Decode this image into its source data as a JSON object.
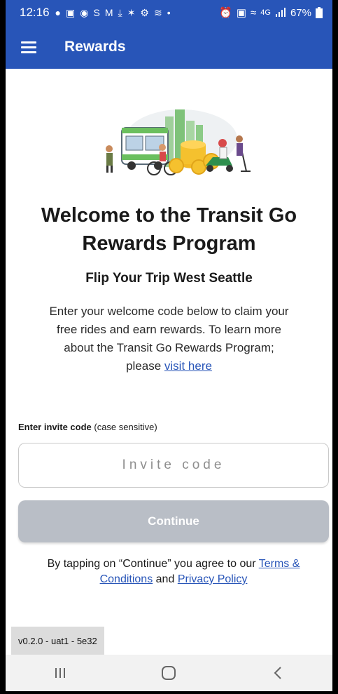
{
  "status_bar": {
    "time": "12:16",
    "left_icons": [
      "●",
      "▣",
      "◉",
      "S",
      "M",
      "⤓",
      "✶",
      "⚙",
      "≋",
      "•"
    ],
    "right_icons": [
      "⏰",
      "▣",
      "≈"
    ],
    "network": "4G",
    "battery": "67%"
  },
  "app_bar": {
    "title": "Rewards"
  },
  "content": {
    "headline": "Welcome to the Transit Go Rewards Program",
    "subheadline": "Flip Your Trip West Seattle",
    "description_text": "Enter your welcome code below to claim your free rides and earn rewards. To learn more about the Transit Go Rewards Program; please",
    "description_link": "visit here"
  },
  "form": {
    "label": "Enter invite code",
    "label_note": "(case sensitive)",
    "input_placeholder": "Invite code",
    "input_value": "",
    "continue_label": "Continue"
  },
  "terms": {
    "prefix": "By tapping on “Continue” you agree to our",
    "terms_link": "Terms & Conditions",
    "and_text": "and",
    "privacy_link": "Privacy Policy"
  },
  "version": "v0.2.0 - uat1 - 5e32",
  "colors": {
    "primary": "#2855b8",
    "disabled_button": "#b9bec6",
    "nav_bar": "#f2f2f2"
  }
}
